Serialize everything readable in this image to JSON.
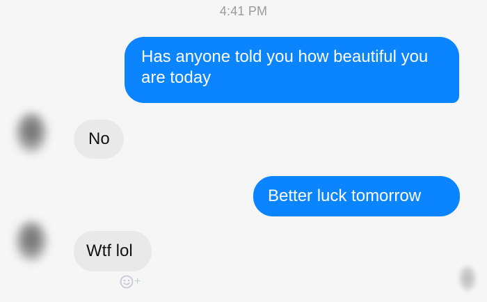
{
  "conversation": {
    "timestamp": "4:41 PM",
    "messages": [
      {
        "direction": "outgoing",
        "text": "Has anyone told you how beautiful you are today"
      },
      {
        "direction": "incoming",
        "text": "No"
      },
      {
        "direction": "outgoing",
        "text": "Better luck tomorrow"
      },
      {
        "direction": "incoming",
        "text": "Wtf lol"
      }
    ],
    "react_plus": "+"
  },
  "colors": {
    "outgoing_bubble": "#0a84ff",
    "incoming_bubble": "#e9e9e9",
    "background": "#f6f6f6",
    "timestamp": "#9a9a9a"
  },
  "icons": {
    "reaction": "add-reaction-icon",
    "avatar": "blurred-avatar",
    "read_receipt": "seen-avatar-icon"
  }
}
